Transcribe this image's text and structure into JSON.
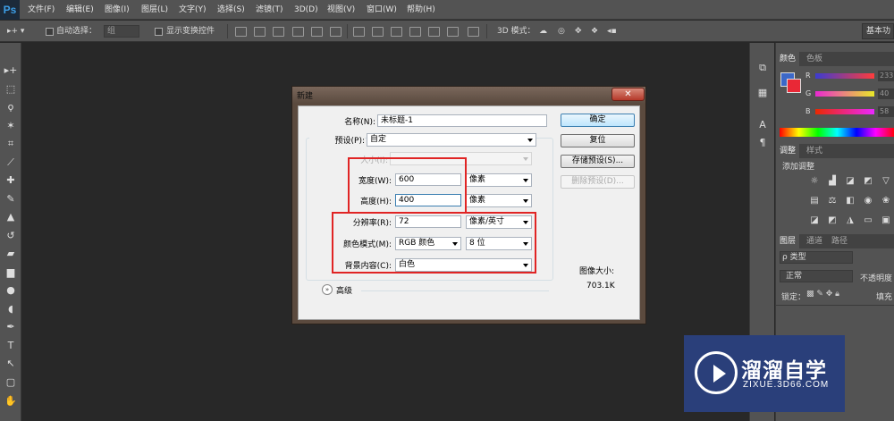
{
  "app": {
    "logo": "Ps"
  },
  "menu": [
    "文件(F)",
    "编辑(E)",
    "图像(I)",
    "图层(L)",
    "文字(Y)",
    "选择(S)",
    "滤镜(T)",
    "3D(D)",
    "视图(V)",
    "窗口(W)",
    "帮助(H)"
  ],
  "options_bar": {
    "auto_select_label": "自动选择：",
    "auto_select_value": "组",
    "show_transform_label": "显示变换控件",
    "mode_3d_label": "3D 模式：",
    "workspace": "基本功"
  },
  "toolbox": {
    "tools": [
      {
        "icon": "move-icon",
        "glyph": "▸+"
      },
      {
        "icon": "marquee-icon",
        "glyph": "⬚"
      },
      {
        "icon": "lasso-icon",
        "glyph": "ϙ"
      },
      {
        "icon": "magic-wand-icon",
        "glyph": "✶"
      },
      {
        "icon": "crop-icon",
        "glyph": "⌗"
      },
      {
        "icon": "eyedropper-icon",
        "glyph": "⟋"
      },
      {
        "icon": "healing-brush-icon",
        "glyph": "✚"
      },
      {
        "icon": "brush-icon",
        "glyph": "✎"
      },
      {
        "icon": "stamp-icon",
        "glyph": "▲"
      },
      {
        "icon": "history-brush-icon",
        "glyph": "↺"
      },
      {
        "icon": "eraser-icon",
        "glyph": "▰"
      },
      {
        "icon": "gradient-icon",
        "glyph": "▆"
      },
      {
        "icon": "blur-icon",
        "glyph": "●"
      },
      {
        "icon": "dodge-icon",
        "glyph": "◖"
      },
      {
        "icon": "pen-icon",
        "glyph": "✒"
      },
      {
        "icon": "type-icon",
        "glyph": "T"
      },
      {
        "icon": "path-selection-icon",
        "glyph": "↖"
      },
      {
        "icon": "rectangle-icon",
        "glyph": "▢"
      },
      {
        "icon": "hand-icon",
        "glyph": "✋"
      }
    ]
  },
  "dialog": {
    "title": "新建",
    "close": "✕",
    "name_label": "名称(N):",
    "name_value": "未标题-1",
    "preset_label": "预设(P):",
    "preset_value": "自定",
    "size_label": "大小(I):",
    "width_label": "宽度(W):",
    "width_value": "600",
    "width_unit": "像素",
    "height_label": "高度(H):",
    "height_value": "400",
    "height_unit": "像素",
    "resolution_label": "分辨率(R):",
    "resolution_value": "72",
    "resolution_unit": "像素/英寸",
    "color_mode_label": "颜色模式(M):",
    "color_mode_value": "RGB 颜色",
    "bit_depth": "8 位",
    "background_label": "背景内容(C):",
    "background_value": "白色",
    "advanced_label": "高级",
    "buttons": {
      "ok": "确定",
      "reset": "复位",
      "save_preset": "存储预设(S)...",
      "delete_preset": "删除预设(D)..."
    },
    "image_size_label": "图像大小:",
    "image_size_value": "703.1K"
  },
  "panels": {
    "color_tabs": [
      "颜色",
      "色板"
    ],
    "sliders": [
      {
        "label": "R",
        "value": "233",
        "gradient": "linear-gradient(to right,#3c3cd0,#ff3c3c)"
      },
      {
        "label": "G",
        "value": "40",
        "gradient": "linear-gradient(to right,#e828d0,#e8e828)"
      },
      {
        "label": "B",
        "value": "58",
        "gradient": "linear-gradient(to right,#e92800,#e928ff)"
      }
    ],
    "adjust_tabs": [
      "调整",
      "样式"
    ],
    "adjust_title": "添加调整",
    "layers_tabs": [
      "图层",
      "通道",
      "路径"
    ],
    "layers_filter": "ρ 类型",
    "blend_mode": "正常",
    "opacity_label": "不透明度",
    "lock_label": "锁定：",
    "fill_label": "填充"
  },
  "watermark": {
    "cn": "溜溜自学",
    "en": "ZIXUE.3D66.COM"
  },
  "colors": {
    "fg": "#e92836",
    "bg": "#3c68c8"
  }
}
